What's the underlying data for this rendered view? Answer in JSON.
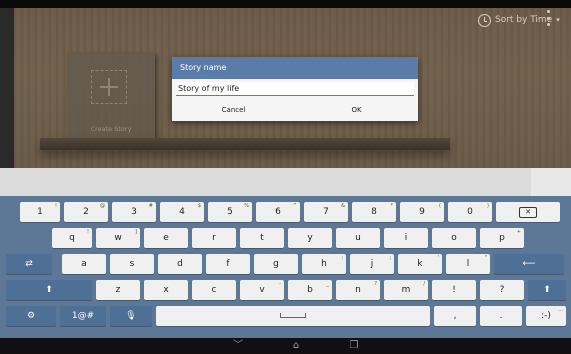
{
  "toolbar": {
    "sort_label": "Sort by Time"
  },
  "shelf": {
    "create_story_label": "Create Story"
  },
  "dialog": {
    "title": "Story name",
    "input_value": "Story of my life",
    "cancel_label": "Cancel",
    "ok_label": "OK"
  },
  "keyboard": {
    "row1": [
      {
        "main": "1",
        "sup": "!"
      },
      {
        "main": "2",
        "sup": "@"
      },
      {
        "main": "3",
        "sup": "#"
      },
      {
        "main": "4",
        "sup": "$"
      },
      {
        "main": "5",
        "sup": "%"
      },
      {
        "main": "6",
        "sup": "^"
      },
      {
        "main": "7",
        "sup": "&"
      },
      {
        "main": "8",
        "sup": "*"
      },
      {
        "main": "9",
        "sup": "("
      },
      {
        "main": "0",
        "sup": ")"
      }
    ],
    "row2": [
      {
        "main": "q",
        "sup": "!"
      },
      {
        "main": "w",
        "sup": "]"
      },
      {
        "main": "e",
        "sup": ""
      },
      {
        "main": "r",
        "sup": ""
      },
      {
        "main": "t",
        "sup": ""
      },
      {
        "main": "y",
        "sup": ""
      },
      {
        "main": "u",
        "sup": ""
      },
      {
        "main": "i",
        "sup": ""
      },
      {
        "main": "o",
        "sup": ""
      },
      {
        "main": "p",
        "sup": "+"
      }
    ],
    "row3": [
      {
        "main": "a",
        "sup": ""
      },
      {
        "main": "s",
        "sup": ""
      },
      {
        "main": "d",
        "sup": ""
      },
      {
        "main": "f",
        "sup": ""
      },
      {
        "main": "g",
        "sup": ""
      },
      {
        "main": "h",
        "sup": ":"
      },
      {
        "main": "j",
        "sup": ";"
      },
      {
        "main": "k",
        "sup": "'"
      },
      {
        "main": "l",
        "sup": "\""
      }
    ],
    "row4": [
      {
        "main": "z",
        "sup": ""
      },
      {
        "main": "x",
        "sup": ""
      },
      {
        "main": "c",
        "sup": ""
      },
      {
        "main": "v",
        "sup": "-"
      },
      {
        "main": "b",
        "sup": "_"
      },
      {
        "main": "n",
        "sup": "?"
      },
      {
        "main": "m",
        "sup": "/"
      },
      {
        "main": "!",
        "sup": ""
      },
      {
        "main": "?",
        "sup": ""
      }
    ],
    "symbols_label": "1@#",
    "comma_label": ",",
    "period_label": ".",
    "emoticon_label": ":-)",
    "emoticon_sup": "...",
    "icons": {
      "backspace": "backspace-icon",
      "tab": "tab-icon",
      "enter": "enter-icon",
      "shift": "shift-icon",
      "settings": "gear-icon",
      "voice": "microphone-icon",
      "space": "space-icon"
    }
  },
  "navbar": {
    "icons": [
      "back-icon",
      "home-icon",
      "recent-apps-icon"
    ]
  },
  "colors": {
    "dialog_title_bg": "#5b7ba8",
    "keyboard_bg": "#5c7896",
    "dark_key": "#4e6f96"
  }
}
